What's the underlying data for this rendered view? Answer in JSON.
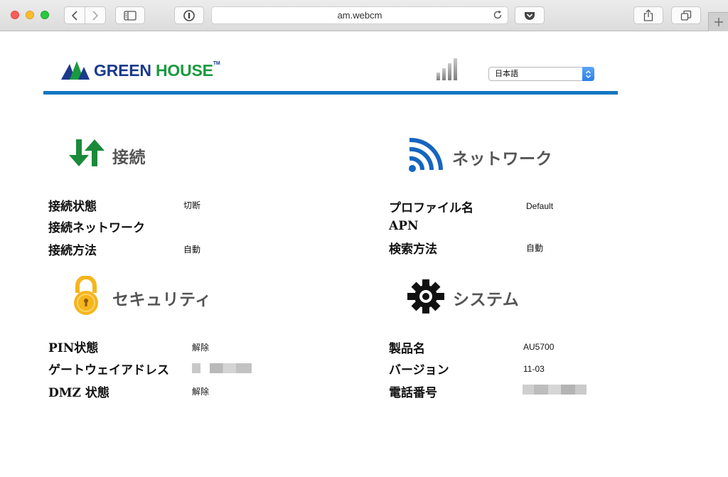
{
  "browser": {
    "url": "am.webcm"
  },
  "header": {
    "logo_text_green": "GREEN",
    "logo_text_house": "HOUSE",
    "logo_tm": "TM",
    "language": "日本語"
  },
  "colors": {
    "brand_blue": "#1b3a8c",
    "brand_green": "#1a9a3f",
    "rule_blue": "#1077c1",
    "connection_green": "#1a8a3a",
    "network_blue": "#1565c0",
    "security_yellow": "#f5b51d",
    "system_black": "#111111"
  },
  "sections": {
    "connection": {
      "title": "接続",
      "icon": "up-down-arrows-icon",
      "rows": [
        {
          "label": "接続状態",
          "value": "切断"
        },
        {
          "label": "接続ネットワーク",
          "value": ""
        },
        {
          "label": "接続方法",
          "value": "自動"
        }
      ]
    },
    "network": {
      "title": "ネットワーク",
      "icon": "wifi-icon",
      "rows": [
        {
          "label": "プロファイル名",
          "value": "Default"
        },
        {
          "label": "APN",
          "value": ""
        },
        {
          "label": "検索方法",
          "value": "自動"
        }
      ]
    },
    "security": {
      "title": "セキュリティ",
      "icon": "padlock-icon",
      "rows": [
        {
          "label": "PIN状態",
          "value": "解除"
        },
        {
          "label": "ゲートウェイアドレス",
          "value": ""
        },
        {
          "label": "DMZ 状態",
          "value": "解除"
        }
      ]
    },
    "system": {
      "title": "システム",
      "icon": "gear-icon",
      "rows": [
        {
          "label": "製品名",
          "value": "AU5700"
        },
        {
          "label": "バージョン",
          "value": "11-03"
        },
        {
          "label": "電話番号",
          "value": ""
        }
      ]
    }
  }
}
